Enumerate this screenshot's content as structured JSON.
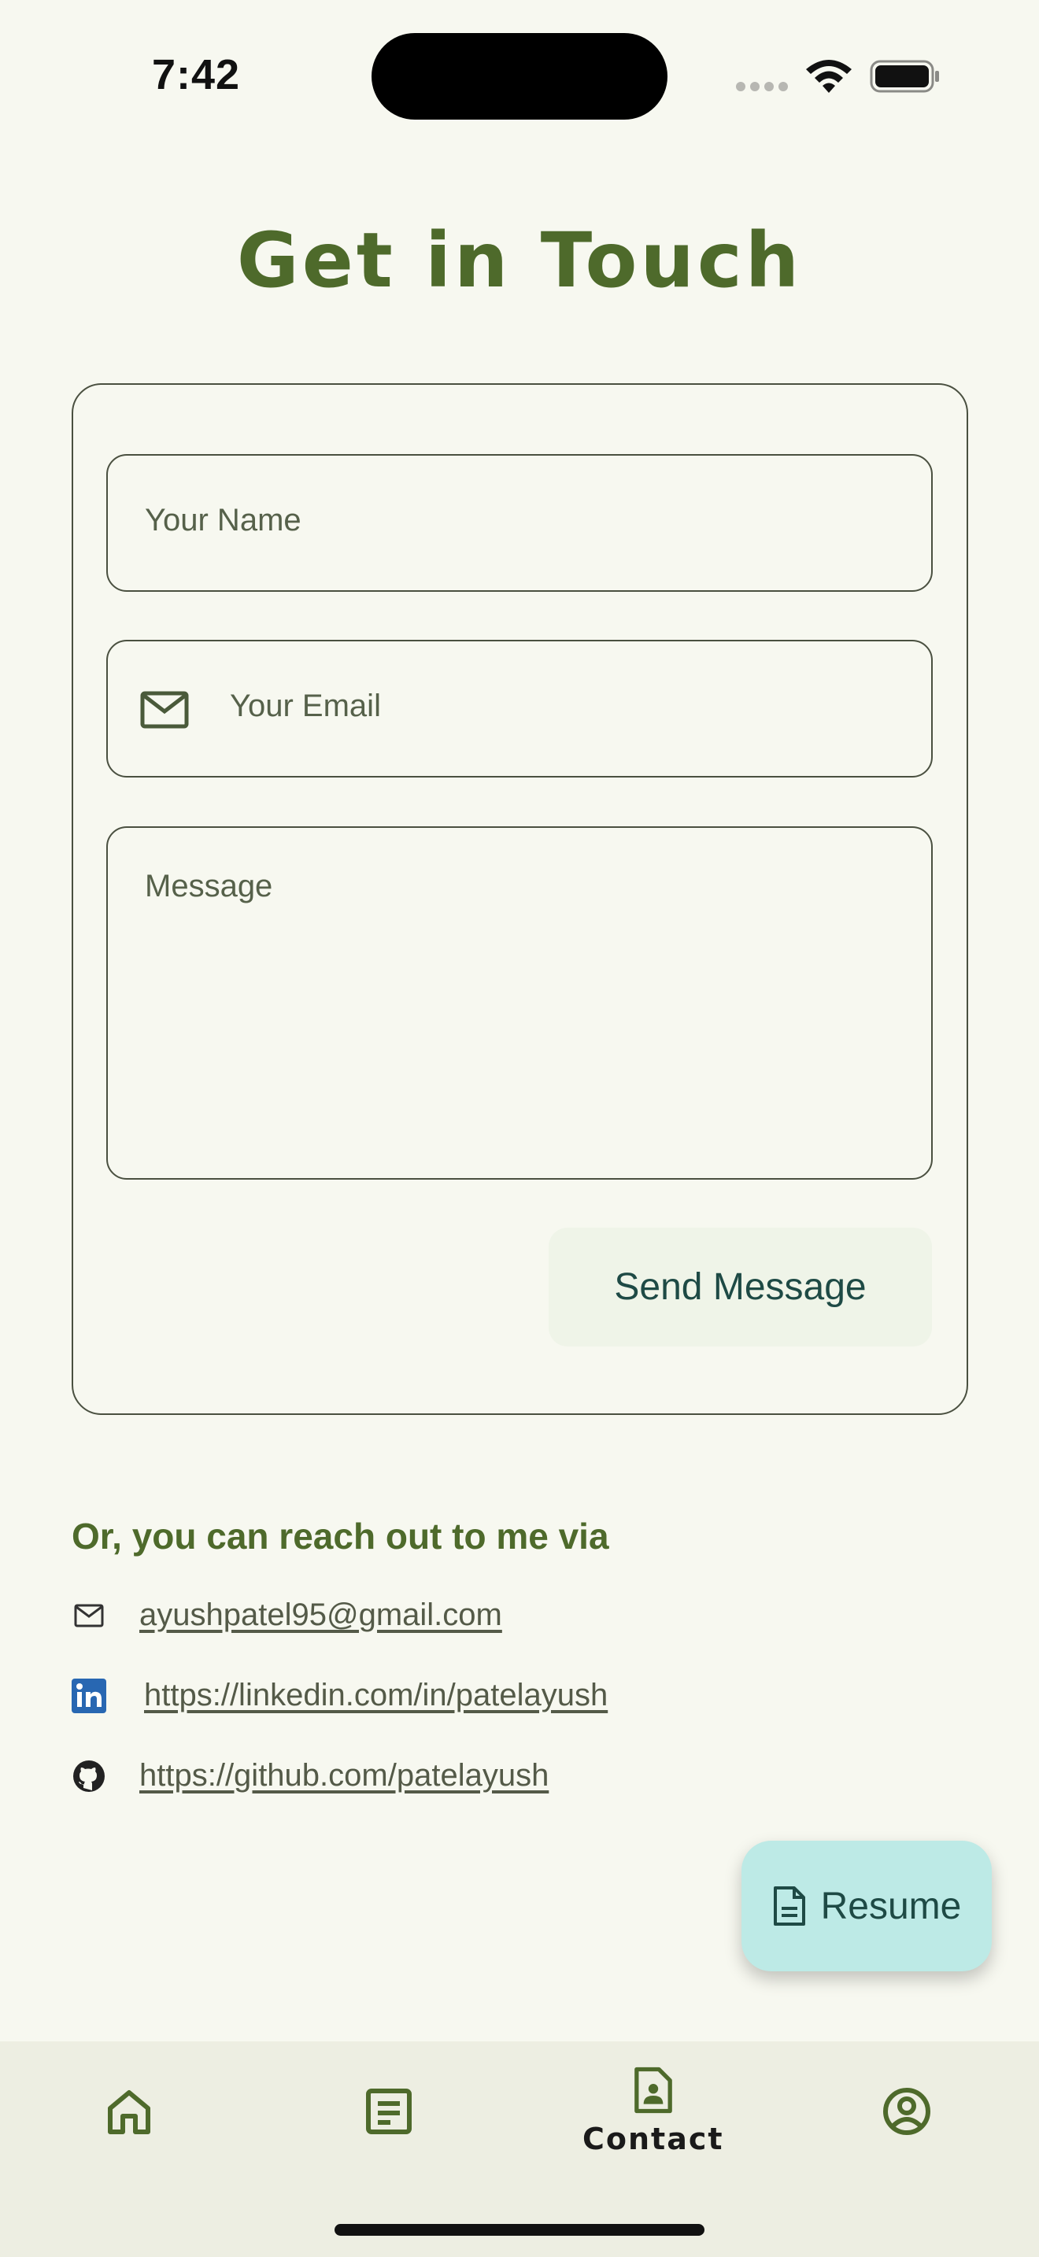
{
  "status_bar": {
    "time": "7:42"
  },
  "page": {
    "title": "Get in Touch"
  },
  "form": {
    "name_placeholder": "Your Name",
    "email_placeholder": "Your Email",
    "message_placeholder": "Message",
    "send_label": "Send Message"
  },
  "reach_out": {
    "heading": "Or, you can reach out to me via",
    "items": [
      {
        "icon": "mail-icon",
        "text": "ayushpatel95@gmail.com"
      },
      {
        "icon": "linkedin-icon",
        "text": "https://linkedin.com/in/patelayush"
      },
      {
        "icon": "github-icon",
        "text": "https://github.com/patelayush"
      }
    ]
  },
  "fab": {
    "label": "Resume",
    "icon": "document-icon"
  },
  "bottom_nav": {
    "items": [
      {
        "name": "home",
        "icon": "home-icon",
        "label": ""
      },
      {
        "name": "projects",
        "icon": "article-icon",
        "label": ""
      },
      {
        "name": "contact",
        "icon": "contact-page-icon",
        "label": "Contact",
        "active": true
      },
      {
        "name": "profile",
        "icon": "account-circle-icon",
        "label": ""
      }
    ]
  },
  "colors": {
    "background": "#f7f8f0",
    "title": "#4e6a2b",
    "fab": "#bdeae6",
    "nav_background": "#edeee2",
    "linkedin": "#2867b2"
  }
}
